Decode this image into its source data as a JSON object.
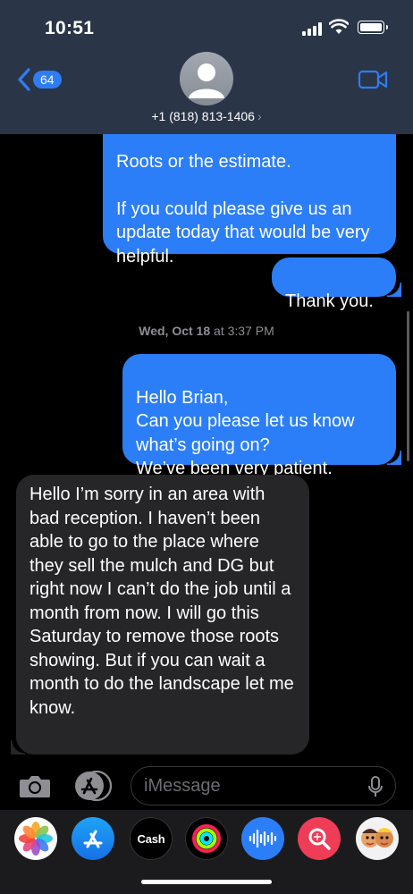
{
  "status": {
    "time": "10:51"
  },
  "header": {
    "back_count": "64",
    "contact": "+1 (818) 813-1406",
    "contact_chevron": "›"
  },
  "messages": {
    "m1": "Roots or the estimate.\n\nIf you could please give us an update today that would be very helpful.",
    "m2": "Thank you.",
    "timestamp_day": "Wed, Oct 18",
    "timestamp_time": " at 3:37 PM",
    "m3": "Hello Brian,\nCan you please let us know what’s going on?\nWe’ve been very patient.",
    "m4": "Hello I’m sorry in an area with bad reception. I haven’t been able to go to the place where they sell the mulch and DG but right now I can’t do the job until a month from now. I will go this Saturday to remove those roots showing. But if you can wait a month to do the landscape let me know."
  },
  "compose": {
    "placeholder": "iMessage"
  },
  "drawer": {
    "apps": [
      "photos-icon",
      "app-store-icon",
      "apple-cash-icon",
      "activity-icon",
      "audio-message-icon",
      "image-search-icon",
      "memoji-icon"
    ],
    "cash_label": "Cash",
    "apple_glyph": ""
  },
  "colors": {
    "header_bg": "#2a3547",
    "sent_bubble": "#2b7ef7",
    "received_bubble": "#262628",
    "accent": "#2e7cf6"
  }
}
